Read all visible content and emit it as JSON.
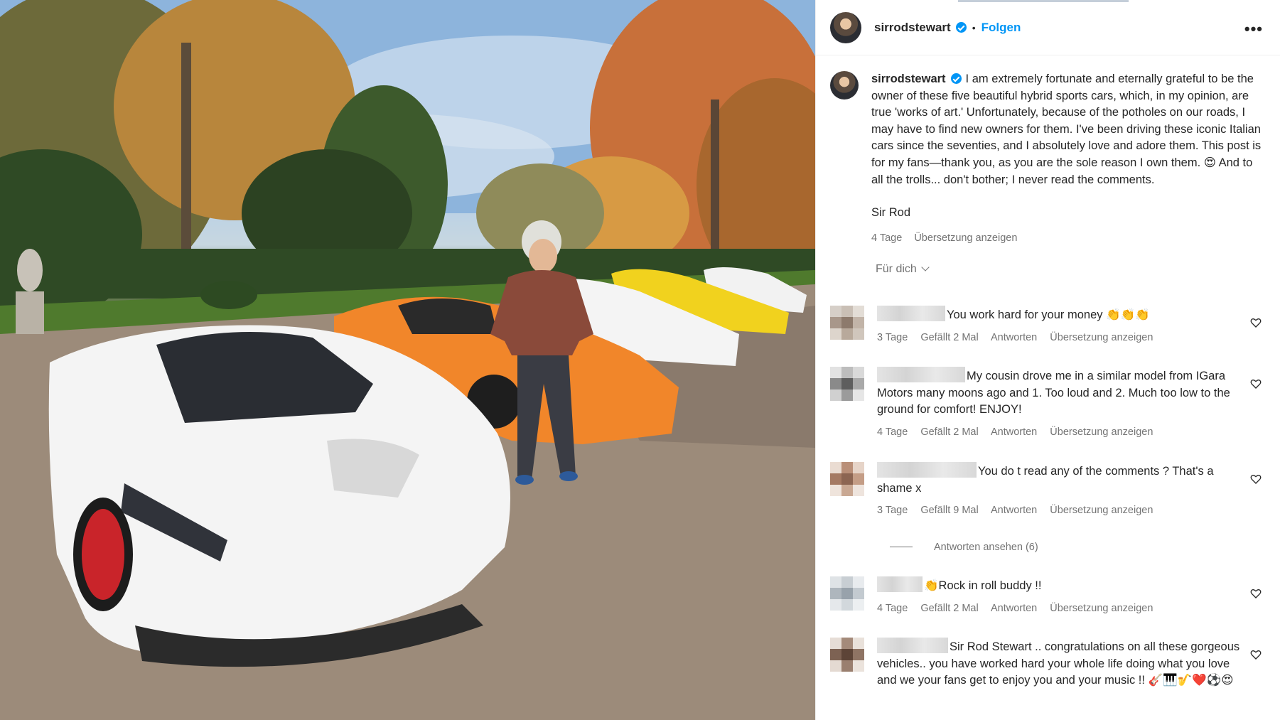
{
  "post": {
    "username": "sirrodstewart",
    "follow_label": "Folgen",
    "separator": "•",
    "more_label": "•••",
    "caption": "I am extremely fortunate and eternally grateful to be the owner of these five beautiful hybrid sports cars, which, in my opinion, are true 'works of art.' Unfortunately, because of the potholes on our roads, I may have to find new owners for them. I've been driving these iconic Italian cars since the seventies, and I absolutely love and adore them. This post is for my fans—thank you, as you are the sole reason I own them. 😍 And to all the trolls... don't bother; I never read the comments.",
    "signature": "Sir Rod",
    "age": "4 Tage",
    "translate_label": "Übersetzung anzeigen"
  },
  "filter": {
    "label": "Für dich"
  },
  "comments": [
    {
      "text": "You work hard for your money 👏👏👏",
      "age": "3 Tage",
      "likes": "Gefällt 2 Mal",
      "reply_label": "Antworten",
      "translate_label": "Übersetzung anzeigen",
      "avatar_colors": [
        "#d6cfc8",
        "#c9bfb5",
        "#e3ddd6",
        "#a8978a",
        "#8d7a6c",
        "#c2b4a8",
        "#ddd5cc",
        "#b8a99b",
        "#d0c6bc"
      ]
    },
    {
      "text": "My cousin drove me in a similar model from IGara Motors many moons ago and 1. Too loud and 2. Much too low to the ground for comfort! ENJOY!",
      "age": "4 Tage",
      "likes": "Gefällt 2 Mal",
      "reply_label": "Antworten",
      "translate_label": "Übersetzung anzeigen",
      "avatar_colors": [
        "#e2e2e2",
        "#bdbdbd",
        "#d9d9d9",
        "#8a8a8a",
        "#5e5e5e",
        "#a9a9a9",
        "#d0d0d0",
        "#9b9b9b",
        "#e6e6e6"
      ]
    },
    {
      "text": "You do t read any of the comments ? That's a shame x",
      "age": "3 Tage",
      "likes": "Gefällt 9 Mal",
      "reply_label": "Antworten",
      "translate_label": "Übersetzung anzeigen",
      "avatar_colors": [
        "#eadcd2",
        "#b98f78",
        "#e6d4c8",
        "#a57a63",
        "#8c6552",
        "#c49d86",
        "#efe4dc",
        "#c9a893",
        "#eee4dd"
      ]
    },
    {
      "text": "👏Rock in roll buddy !!",
      "age": "4 Tage",
      "likes": "Gefällt 2 Mal",
      "reply_label": "Antworten",
      "translate_label": "Übersetzung anzeigen",
      "avatar_colors": [
        "#dfe3e6",
        "#c8ced3",
        "#e8ebee",
        "#aeb6bd",
        "#98a2ab",
        "#c3cad0",
        "#e5e8eb",
        "#d2d8dc",
        "#eceff1"
      ]
    },
    {
      "text": "Sir Rod Stewart .. congratulations on all these gorgeous vehicles.. you have worked hard your whole life doing what you love and we your fans get to enjoy you and your music !! 🎸🎹🎷❤️⚽😍",
      "age": "",
      "likes": "",
      "reply_label": "",
      "translate_label": "",
      "avatar_colors": [
        "#e6ddd6",
        "#a48a7a",
        "#e9e1da",
        "#7d6253",
        "#5d4437",
        "#8f7464",
        "#e4dad2",
        "#9a7f6f",
        "#ebe3dc"
      ]
    }
  ],
  "view_replies": {
    "label": "Antworten ansehen (6)"
  },
  "colors": {
    "accent": "#0095f6",
    "muted": "#737373",
    "text": "#262626"
  },
  "icons": {
    "verified": "verified-badge-icon",
    "heart": "heart-outline-icon",
    "more": "more-options-icon",
    "chevron": "chevron-down-icon"
  }
}
